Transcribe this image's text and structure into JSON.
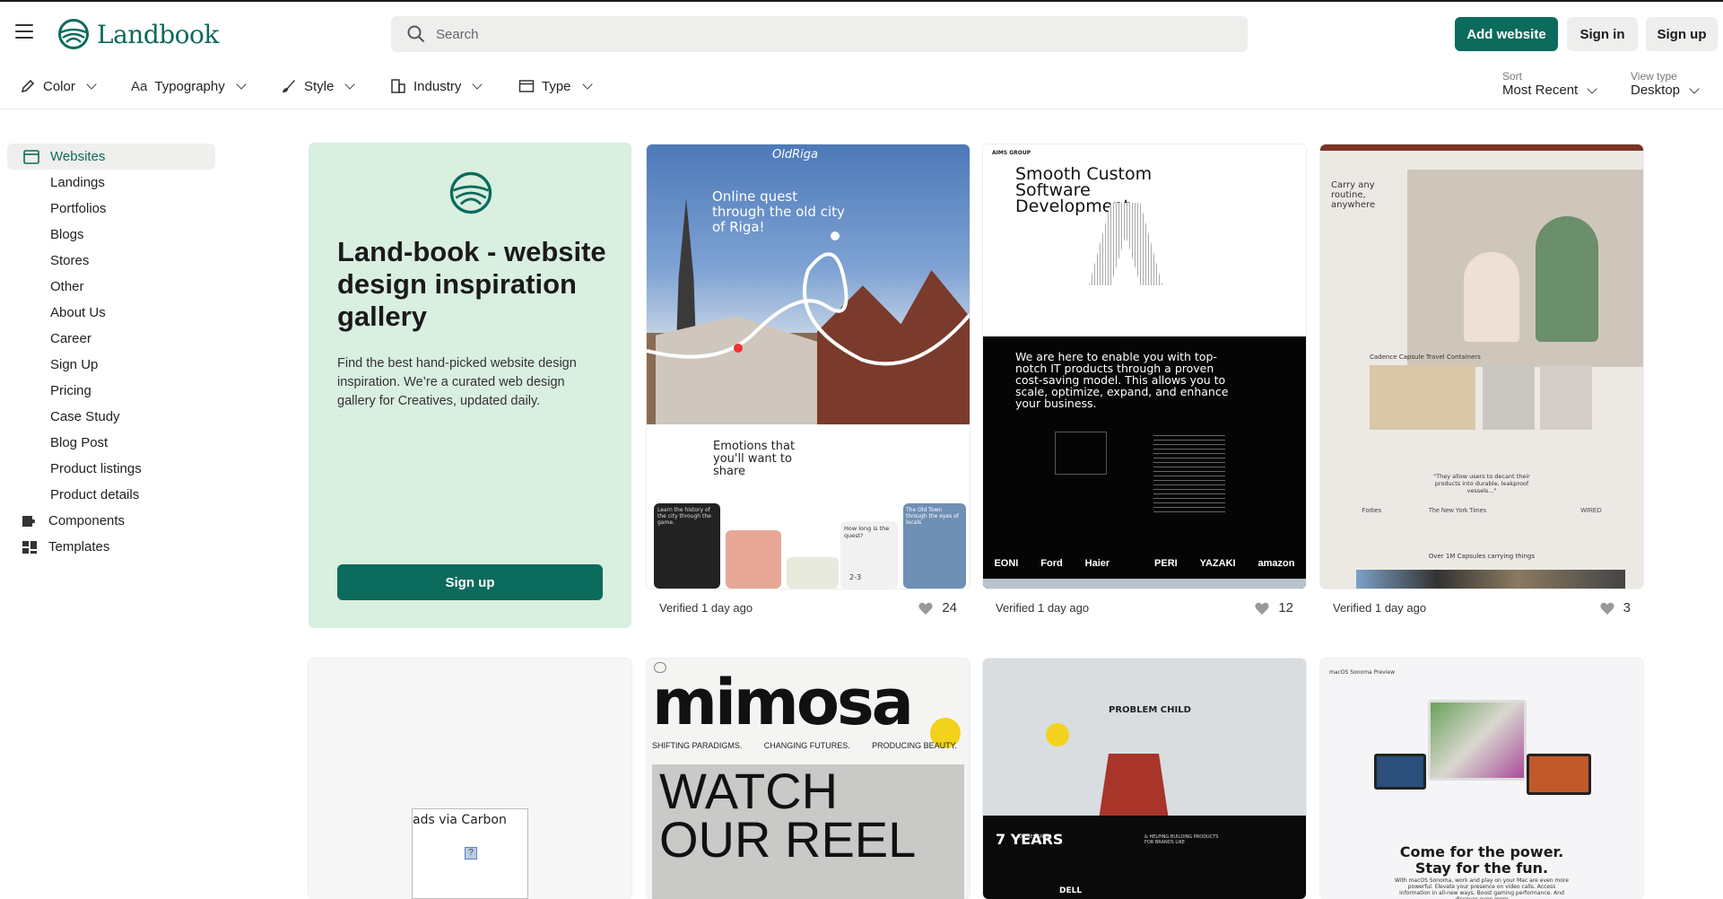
{
  "header": {
    "logo_text": "Landbook",
    "search_placeholder": "Search",
    "add_website": "Add website",
    "sign_in": "Sign in",
    "sign_up": "Sign up",
    "brand_color": "#0b6b5c"
  },
  "filters": {
    "items": [
      {
        "label": "Color",
        "icon": "pencil-icon"
      },
      {
        "label": "Typography",
        "icon": "typography-icon"
      },
      {
        "label": "Style",
        "icon": "brush-icon"
      },
      {
        "label": "Industry",
        "icon": "industry-icon"
      },
      {
        "label": "Type",
        "icon": "window-icon"
      }
    ],
    "sort_label": "Sort",
    "sort_value": "Most Recent",
    "view_label": "View type",
    "view_value": "Desktop"
  },
  "sidebar": {
    "websites": "Websites",
    "sub_items": [
      "Landings",
      "Portfolios",
      "Blogs",
      "Stores",
      "Other",
      "About Us",
      "Career",
      "Sign Up",
      "Pricing",
      "Case Study",
      "Blog Post",
      "Product listings",
      "Product details"
    ],
    "components": "Components",
    "templates": "Templates"
  },
  "hero": {
    "title": "Land-book - website design inspiration gallery",
    "description": "Find the best hand-picked website design inspiration. We’re a curated web design gallery for Creatives, updated daily.",
    "button": "Sign up"
  },
  "cards": [
    {
      "verified": "Verified 1 day ago",
      "likes": "24",
      "texts": {
        "brand": "OldRiga",
        "headline": "Online quest through the old city of Riga!",
        "sub": "Emotions that you'll want to share",
        "tile1": "Learn the history of the city through the game.",
        "tile2": "How long is the quest?",
        "tile3": "The Old Town through the eyes of locals",
        "tile4": "2-3"
      }
    },
    {
      "verified": "Verified 1 day ago",
      "likes": "12",
      "texts": {
        "brand": "AIMS GROUP",
        "headline": "Smooth Custom Software Development",
        "body": "We are here to enable you with top-notch IT products through a proven cost-saving model. This allows you to scale, optimize, expand, and enhance your business.",
        "logos": [
          "EONI",
          "Ford",
          "Haier",
          "",
          "PERI",
          "YAZAKI",
          "amazon"
        ]
      }
    },
    {
      "verified": "Verified 1 day ago",
      "likes": "3",
      "texts": {
        "headline": "Carry any routine, anywhere",
        "section": "Cadence Capsule Travel Containers",
        "quote": "\"They allow users to decant their products into durable, leakproof vessels...\"",
        "press": [
          "Forbes",
          "The New York Times",
          "",
          "WIRED"
        ],
        "footer": "Over 1M Capsules carrying things"
      }
    }
  ],
  "row2": {
    "ad_text": "ads via Carbon",
    "mimosa": {
      "word": "mimosa",
      "tags": [
        "SHIFTING PARADIGMS.",
        "CHANGING FUTURES.",
        "PRODUCING BEAUTY."
      ],
      "reel": [
        "WATCH",
        "OUR REEL"
      ]
    },
    "problem_child": {
      "title": "PROBLEM CHILD",
      "years": "7 YEARS",
      "years_sub": "OF DESIGNING",
      "right_text": "& HELPING BUILDING PRODUCTS FOR BRANDS LIKE",
      "brand": "DELL"
    },
    "macos": {
      "small": "macOS Sonoma Preview",
      "headline1": "Come for the power.",
      "headline2": "Stay for the fun.",
      "body": "With macOS Sonoma, work and play on your Mac are even more powerful. Elevate your presence on video calls. Access information in all-new ways. Boost gaming performance. And discover even more"
    }
  }
}
